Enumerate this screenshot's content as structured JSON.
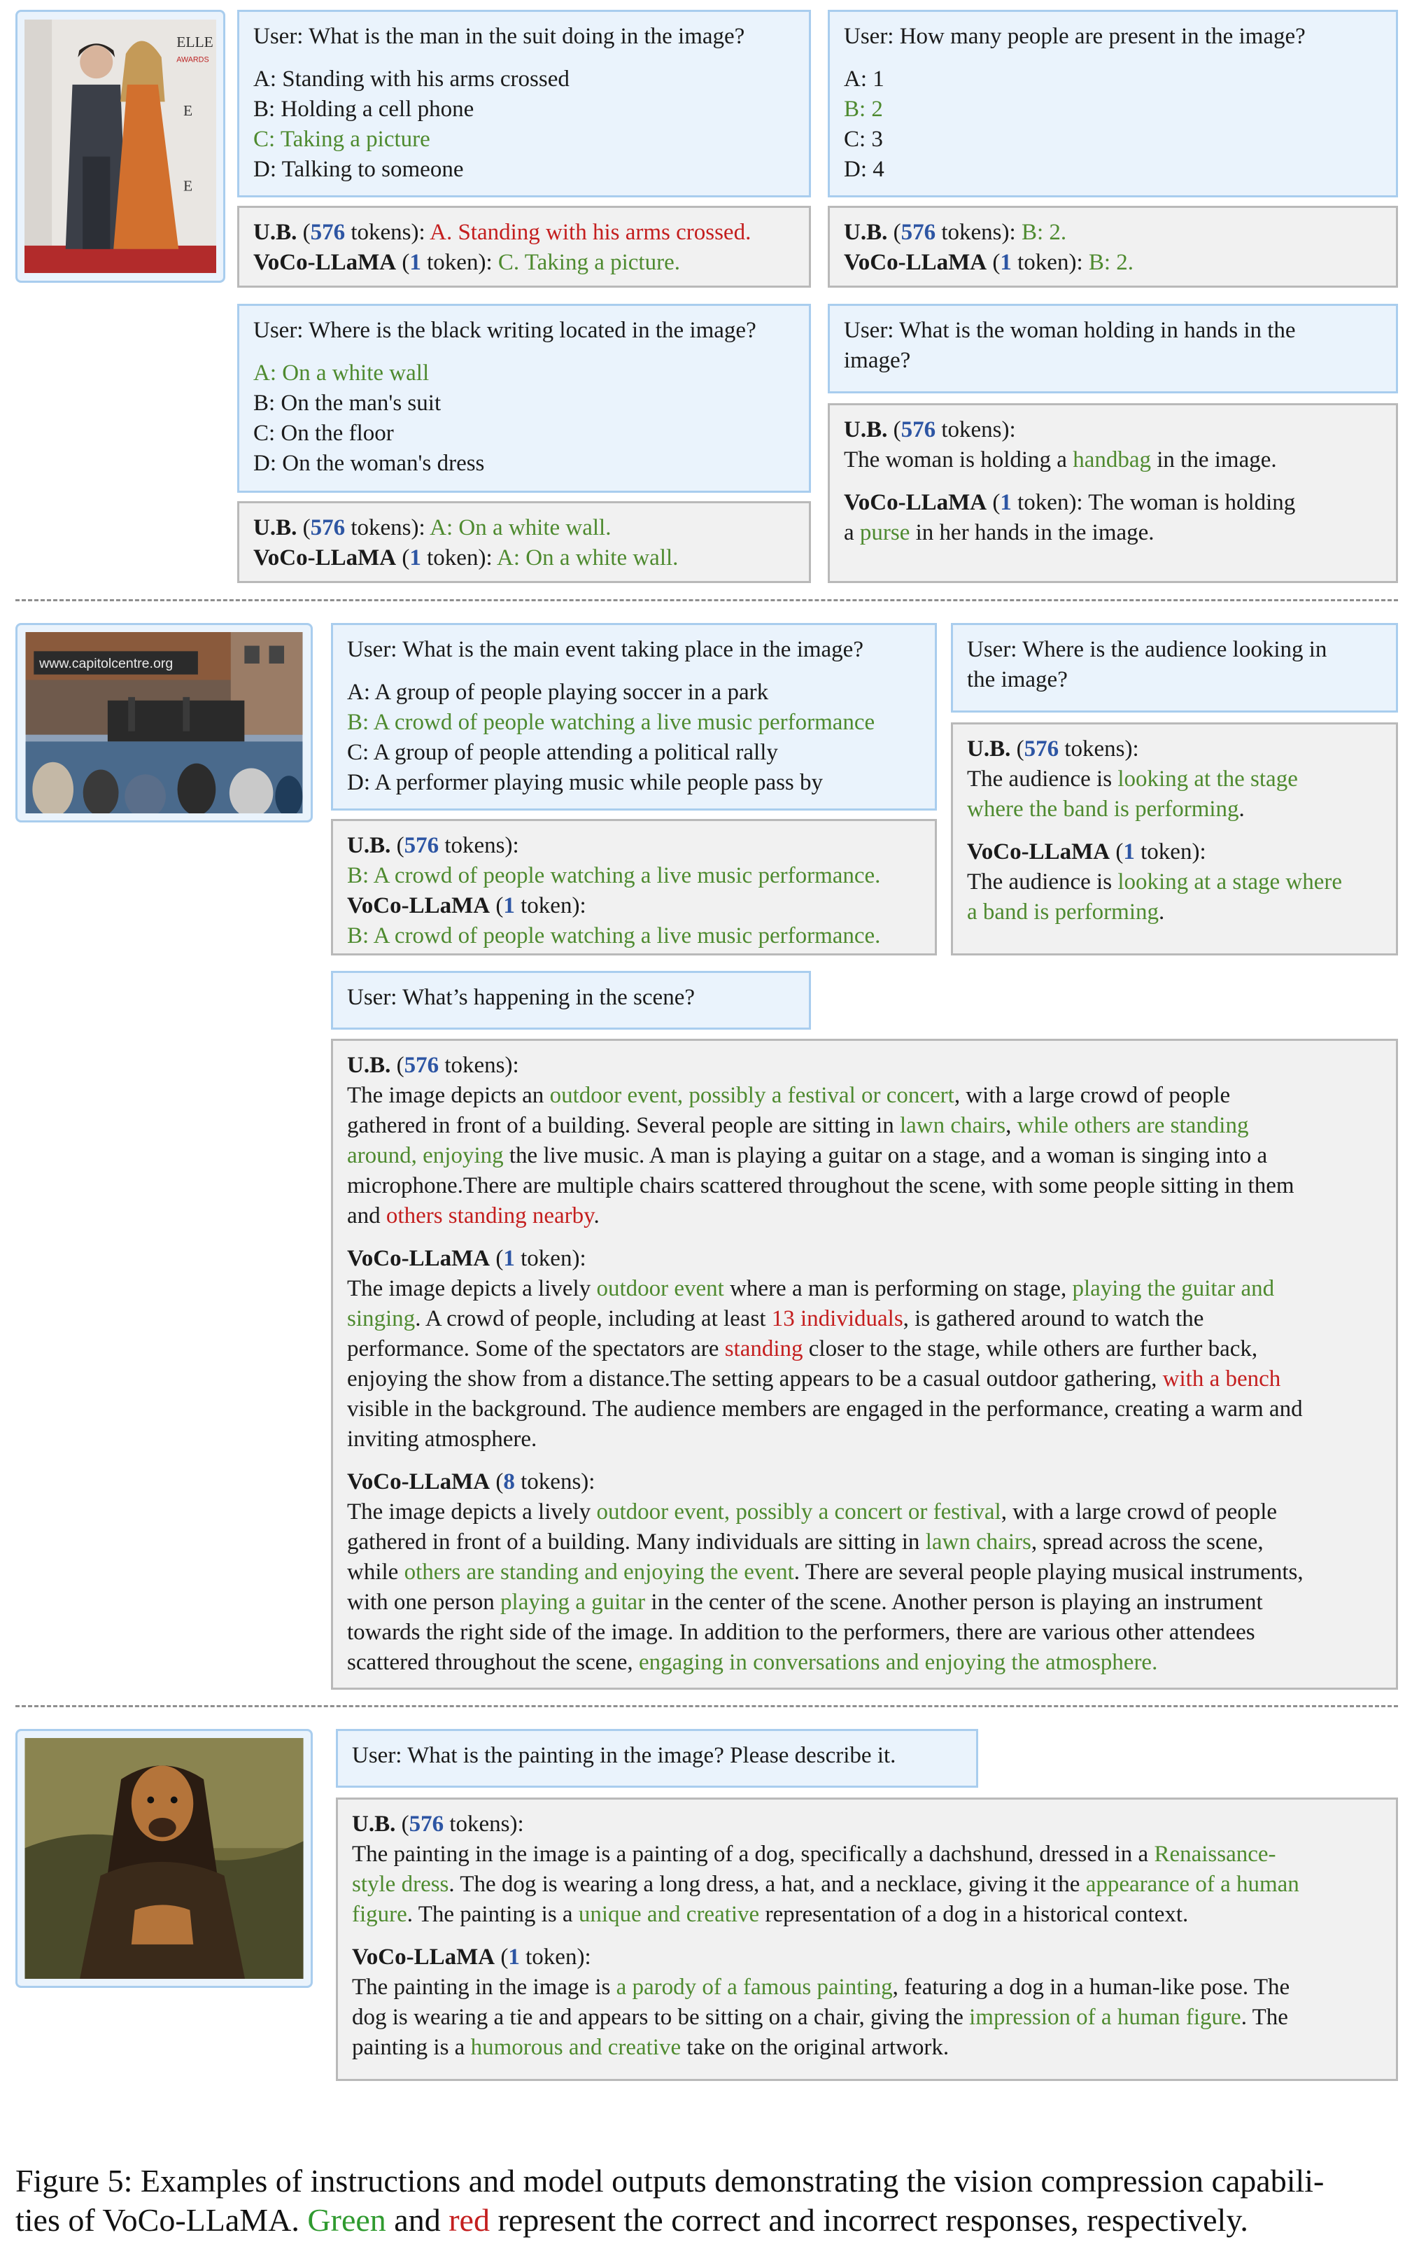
{
  "labels": {
    "ub": "U.B.",
    "voco": "VoCo-LLaMA",
    "t576": "576",
    "t1": "1",
    "t8": "8",
    "tokens": "tokens",
    "token": "token"
  },
  "images": {
    "img1_logo_text": "ELLE",
    "img1_awards_text": "AWARDS",
    "img2_site_text": "www.capitolcentre.org"
  },
  "s1": {
    "q1": {
      "question": "User: What is the man in the suit doing in the image?",
      "options": [
        "A: Standing with his arms crossed",
        "B: Holding a cell phone",
        "C: Taking a picture",
        "D: Talking to someone"
      ],
      "ub_answer": "A. Standing with his arms crossed.",
      "voco_answer": "C. Taking a picture."
    },
    "q2": {
      "question": "User: How many people are present in the image?",
      "options": [
        "A: 1",
        "B: 2",
        "C: 3",
        "D: 4"
      ],
      "ub_answer": "B: 2.",
      "voco_answer": "B: 2."
    },
    "q3": {
      "question": "User: Where is the black writing located in the image?",
      "options": [
        "A: On a white wall",
        "B: On the man's suit",
        "C: On the floor",
        "D: On the woman's dress"
      ],
      "ub_answer": "A: On a white wall.",
      "voco_answer": "A: On a white wall."
    },
    "q4": {
      "question_l1": "User: What is the woman holding in hands in the",
      "question_l2": "image?",
      "ub_prefix": "The woman is holding a ",
      "ub_green": "handbag",
      "ub_suffix": " in the image.",
      "voco_l1": " token): The woman is holding",
      "voco_prefix": "a ",
      "voco_green": "purse",
      "voco_suffix": " in her hands in the image."
    }
  },
  "s2": {
    "q1": {
      "question": "User: What is the main event taking place in the image?",
      "options": [
        "A: A group of people playing soccer in a park",
        "B: A crowd of people watching a live music performance",
        "C: A group of people attending a political rally",
        "D: A performer playing music while people pass by"
      ],
      "ub_answer": "B: A crowd of people watching a live music performance.",
      "voco_answer": "B: A crowd of people watching a live music performance."
    },
    "q2": {
      "question_l1": "User: Where is the audience looking in",
      "question_l2": "the image?",
      "ub_prefix": "The audience is ",
      "ub_green_l1": "looking at the stage",
      "ub_green_l2": "where the band is performing",
      "ub_suffix": ".",
      "voco_prefix": "The audience is ",
      "voco_green_l1": "looking at a stage where",
      "voco_green_l2": "a band is performing",
      "voco_suffix": "."
    },
    "q3": {
      "question": "User: What’s happening in the scene?",
      "ub_p1": "The image depicts an ",
      "ub_g1": "outdoor event, possibly a festival or concert",
      "ub_p2": ", with a large crowd of people",
      "ub_p3": "gathered in front of a building. Several people are sitting in ",
      "ub_g2": "lawn chairs",
      "ub_p4": ", ",
      "ub_g3a": "while others are standing",
      "ub_g3b": "around, enjoying",
      "ub_p5": " the live music. A man is playing a guitar on a stage, and a woman is singing into a",
      "ub_p6": "microphone.There are multiple chairs scattered throughout the scene, with some people sitting in them",
      "ub_p7": "and ",
      "ub_r1": "others standing nearby",
      "ub_p8": ".",
      "v1_p1": "The image depicts a lively ",
      "v1_g1": "outdoor event",
      "v1_p2": " where a man is performing on stage, ",
      "v1_g2a": "playing the guitar and",
      "v1_g2b": "singing",
      "v1_p3": ". A crowd of people, including at least ",
      "v1_r1": "13 individuals",
      "v1_p4": ", is gathered around to watch the",
      "v1_p5": "performance. Some of the spectators are ",
      "v1_r2": "standing",
      "v1_p6": " closer to the stage, while others are further back,",
      "v1_p7": "enjoying the show from a distance.The setting appears to be a casual outdoor gathering, ",
      "v1_r3": "with a bench",
      "v1_p8": "visible in the background. The audience members are engaged in the performance, creating a warm and",
      "v1_p9": "inviting atmosphere.",
      "v8_p1": "The image depicts a lively ",
      "v8_g1": "outdoor event, possibly a concert or festival",
      "v8_p2": ", with a large crowd of people",
      "v8_p3": "gathered in front of a building. Many individuals are sitting in ",
      "v8_g2": "lawn chairs",
      "v8_p4": ", spread across the scene,",
      "v8_p5": "while ",
      "v8_g3": "others are standing and enjoying the event",
      "v8_p6": ". There are several people playing musical instruments,",
      "v8_p7": "with one person ",
      "v8_g4": "playing a guitar",
      "v8_p8": " in the center of the scene. Another person is playing an instrument",
      "v8_p9": "towards the right side of the image. In addition to the performers, there are various other attendees",
      "v8_p10": "scattered throughout the scene, ",
      "v8_g5": "engaging in conversations and enjoying the atmosphere."
    }
  },
  "s3": {
    "question": "User: What is the painting in the image? Please describe it.",
    "ub_p1": "The painting in the image is a painting of a dog, specifically a dachshund, dressed in a ",
    "ub_g1a": "Renaissance-",
    "ub_g1b": "style dress",
    "ub_p2": ". The dog is wearing a long dress, a hat, and a necklace, giving it the ",
    "ub_g2a": "appearance of a human",
    "ub_g2b": "figure",
    "ub_p3": ". The painting is a ",
    "ub_g3": "unique and creative",
    "ub_p4": " representation of a dog in a historical context.",
    "v_p1": "The painting in the image is ",
    "v_g1": "a parody of a famous painting",
    "v_p2": ", featuring a dog in a human-like pose. The",
    "v_p3": "dog is wearing a tie and appears to be sitting on a chair, giving the ",
    "v_g2": "impression of a human figure",
    "v_p4": ". The",
    "v_p5": "painting is a ",
    "v_g3": "humorous and creative",
    "v_p6": " take on the original artwork."
  },
  "caption": {
    "l1": "Figure 5: Examples of instructions and model outputs demonstrating the vision compression capabili-",
    "l2a": "ties of VoCo-LLaMA. ",
    "green": "Green",
    "l2b": " and ",
    "red": "red",
    "l2c": " represent the correct and incorrect responses, respectively."
  },
  "colors": {
    "correct": "#4e8a2f",
    "incorrect": "#c41e1e",
    "token_count": "#2d55a3",
    "question_bg": "#eaf3fc",
    "answer_bg": "#f1f1f1"
  }
}
